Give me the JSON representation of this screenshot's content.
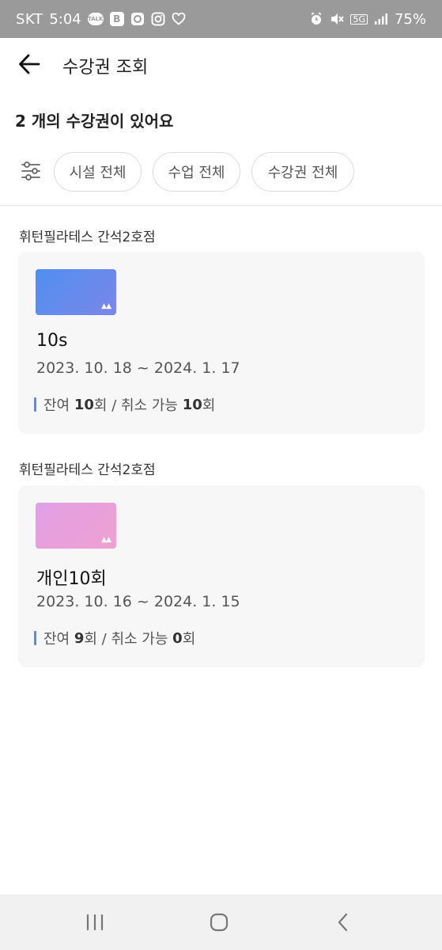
{
  "status_bar": {
    "carrier": "SKT",
    "time": "5:04",
    "talk_label": "TALK",
    "b_label": "B",
    "network": "5G",
    "battery": "75%"
  },
  "header": {
    "title": "수강권 조회"
  },
  "summary": {
    "count_text": "2 개의 수강권이 있어요"
  },
  "filters": {
    "chips": [
      {
        "label": "시설 전체"
      },
      {
        "label": "수업 전체"
      },
      {
        "label": "수강권 전체"
      }
    ]
  },
  "passes": [
    {
      "facility": "휘턴필라테스 간석2호점",
      "name": "10s",
      "period": "2023. 10. 18 ~ 2024. 1. 17",
      "remaining_label": "잔여",
      "remaining": "10",
      "remaining_unit": "회 / 취소 가능",
      "cancellable": "10",
      "cancellable_unit": "회",
      "thumb_color_start": "#4f8ff0",
      "thumb_color_end": "#7b86ea"
    },
    {
      "facility": "휘턴필라테스 간석2호점",
      "name": "개인10회",
      "period": "2023. 10. 16 ~ 2024. 1. 15",
      "remaining_label": "잔여",
      "remaining": "9",
      "remaining_unit": "회 / 취소 가능",
      "cancellable": "0",
      "cancellable_unit": "회",
      "thumb_color_start": "#e0a0e6",
      "thumb_color_end": "#f0a0d0"
    }
  ],
  "colors": {
    "status_bar_bg": "#9a9a9a",
    "accent": "#4f8fe6",
    "card_bg": "#f7f7f8",
    "nav_bg": "#f1f1f1"
  },
  "icons": {
    "back": "arrow-left-icon",
    "filter": "sliders-icon",
    "nav_recent": "recent-apps-icon",
    "nav_home": "home-icon",
    "nav_back": "chevron-left-icon"
  }
}
